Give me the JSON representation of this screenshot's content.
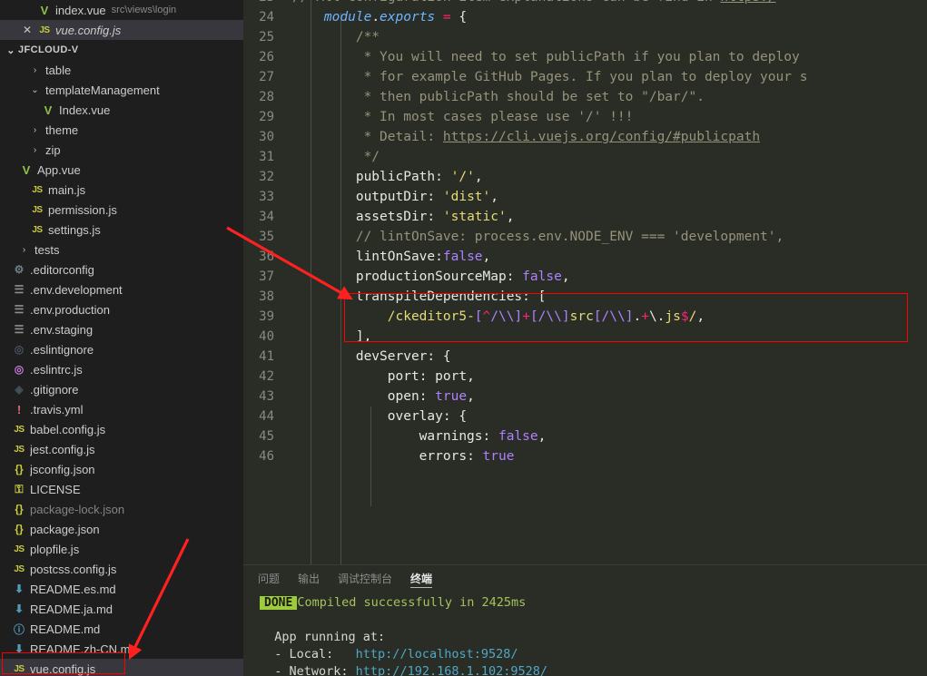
{
  "window": {
    "theme": "dark",
    "editor_bg": "#2a2c26",
    "sidebar_bg": "#1e1e1e",
    "annotation_color": "#ff0000"
  },
  "open_editors": [
    {
      "icon": "vue-icon",
      "name": "index.vue",
      "path": "src\\views\\login",
      "active": false,
      "close": ""
    },
    {
      "icon": "js-icon",
      "name": "vue.config.js",
      "path": "",
      "active": true,
      "close": "✕"
    }
  ],
  "explorer": {
    "root_label": "JFCLOUD-V",
    "root_twisty": "⌄",
    "items": [
      {
        "label": "table",
        "icon": "folder-chevron",
        "chev": "›",
        "indent": 3,
        "kind": "folder"
      },
      {
        "label": "templateManagement",
        "icon": "folder-chevron",
        "chev": "⌄",
        "indent": 3,
        "kind": "folder"
      },
      {
        "label": "Index.vue",
        "icon": "vue-icon",
        "chev": "",
        "indent": 4,
        "kind": "file"
      },
      {
        "label": "theme",
        "icon": "folder-chevron",
        "chev": "›",
        "indent": 3,
        "kind": "folder"
      },
      {
        "label": "zip",
        "icon": "folder-chevron",
        "chev": "›",
        "indent": 3,
        "kind": "folder"
      },
      {
        "label": "App.vue",
        "icon": "vue-icon",
        "chev": "",
        "indent": 2,
        "kind": "file"
      },
      {
        "label": "main.js",
        "icon": "js-icon",
        "chev": "",
        "indent": 3,
        "kind": "file"
      },
      {
        "label": "permission.js",
        "icon": "js-icon",
        "chev": "",
        "indent": 3,
        "kind": "file"
      },
      {
        "label": "settings.js",
        "icon": "js-icon",
        "chev": "",
        "indent": 3,
        "kind": "file"
      },
      {
        "label": "tests",
        "icon": "folder-chevron",
        "chev": "›",
        "indent": 2,
        "kind": "folder"
      },
      {
        "label": ".editorconfig",
        "icon": "gear-icon",
        "chev": "",
        "indent": 1,
        "kind": "file"
      },
      {
        "label": ".env.development",
        "icon": "env-icon",
        "chev": "",
        "indent": 1,
        "kind": "file"
      },
      {
        "label": ".env.production",
        "icon": "env-icon",
        "chev": "",
        "indent": 1,
        "kind": "file"
      },
      {
        "label": ".env.staging",
        "icon": "env-icon",
        "chev": "",
        "indent": 1,
        "kind": "file"
      },
      {
        "label": ".eslintignore",
        "icon": "eslint-grey-icon",
        "chev": "",
        "indent": 1,
        "kind": "file"
      },
      {
        "label": ".eslintrc.js",
        "icon": "eslint-purple-icon",
        "chev": "",
        "indent": 1,
        "kind": "file"
      },
      {
        "label": ".gitignore",
        "icon": "git-icon",
        "chev": "",
        "indent": 1,
        "kind": "file"
      },
      {
        "label": ".travis.yml",
        "icon": "yml-icon",
        "chev": "",
        "indent": 1,
        "kind": "file"
      },
      {
        "label": "babel.config.js",
        "icon": "js-icon",
        "chev": "",
        "indent": 1,
        "kind": "file"
      },
      {
        "label": "jest.config.js",
        "icon": "js-icon",
        "chev": "",
        "indent": 1,
        "kind": "file"
      },
      {
        "label": "jsconfig.json",
        "icon": "json-icon",
        "chev": "",
        "indent": 1,
        "kind": "file"
      },
      {
        "label": "LICENSE",
        "icon": "license-icon",
        "chev": "",
        "indent": 1,
        "kind": "file"
      },
      {
        "label": "package-lock.json",
        "icon": "json-icon",
        "chev": "",
        "indent": 1,
        "kind": "file",
        "dim": true
      },
      {
        "label": "package.json",
        "icon": "json-icon",
        "chev": "",
        "indent": 1,
        "kind": "file"
      },
      {
        "label": "plopfile.js",
        "icon": "js-icon",
        "chev": "",
        "indent": 1,
        "kind": "file"
      },
      {
        "label": "postcss.config.js",
        "icon": "js-icon",
        "chev": "",
        "indent": 1,
        "kind": "file"
      },
      {
        "label": "README.es.md",
        "icon": "md-icon",
        "chev": "",
        "indent": 1,
        "kind": "file"
      },
      {
        "label": "README.ja.md",
        "icon": "md-icon",
        "chev": "",
        "indent": 1,
        "kind": "file"
      },
      {
        "label": "README.md",
        "icon": "md-info-icon",
        "chev": "",
        "indent": 1,
        "kind": "file"
      },
      {
        "label": "README.zh-CN.md",
        "icon": "md-icon",
        "chev": "",
        "indent": 1,
        "kind": "file"
      },
      {
        "label": "vue.config.js",
        "icon": "js-icon",
        "chev": "",
        "indent": 1,
        "kind": "file",
        "selected": true
      }
    ]
  },
  "code": {
    "language": "javascript",
    "file": "vue.config.js",
    "lines": [
      {
        "num": "23",
        "partial_top": true,
        "tokens": [
          {
            "t": "// All configuration item explanations can be find in ",
            "c": "cmt"
          },
          {
            "t": "https:/",
            "c": "link"
          }
        ]
      },
      {
        "num": "24",
        "tokens": [
          {
            "t": "    ",
            "c": "def"
          },
          {
            "t": "module",
            "c": "key"
          },
          {
            "t": ".",
            "c": "def"
          },
          {
            "t": "exports",
            "c": "key"
          },
          {
            "t": " ",
            "c": "def"
          },
          {
            "t": "=",
            "c": "op"
          },
          {
            "t": " ",
            "c": "def"
          },
          {
            "t": "{",
            "c": "brace"
          }
        ]
      },
      {
        "num": "25",
        "tokens": [
          {
            "t": "        /**",
            "c": "cmt"
          }
        ]
      },
      {
        "num": "26",
        "tokens": [
          {
            "t": "         * You will need to set publicPath if you plan to deploy",
            "c": "cmt"
          }
        ]
      },
      {
        "num": "27",
        "tokens": [
          {
            "t": "         * for example GitHub Pages. If you plan to deploy your s",
            "c": "cmt"
          }
        ]
      },
      {
        "num": "28",
        "tokens": [
          {
            "t": "         * then publicPath should be set to \"/bar/\".",
            "c": "cmt"
          }
        ]
      },
      {
        "num": "29",
        "tokens": [
          {
            "t": "         * In most cases please use '/' !!!",
            "c": "cmt"
          }
        ]
      },
      {
        "num": "30",
        "tokens": [
          {
            "t": "         * Detail: ",
            "c": "cmt"
          },
          {
            "t": "https://cli.vuejs.org/config/#publicpath",
            "c": "link"
          }
        ]
      },
      {
        "num": "31",
        "tokens": [
          {
            "t": "         */",
            "c": "cmt"
          }
        ]
      },
      {
        "num": "32",
        "tokens": [
          {
            "t": "        publicPath",
            "c": "prop"
          },
          {
            "t": ": ",
            "c": "def"
          },
          {
            "t": "'/'",
            "c": "str"
          },
          {
            "t": ",",
            "c": "def"
          }
        ]
      },
      {
        "num": "33",
        "tokens": [
          {
            "t": "        outputDir",
            "c": "prop"
          },
          {
            "t": ": ",
            "c": "def"
          },
          {
            "t": "'dist'",
            "c": "str"
          },
          {
            "t": ",",
            "c": "def"
          }
        ]
      },
      {
        "num": "34",
        "tokens": [
          {
            "t": "        assetsDir",
            "c": "prop"
          },
          {
            "t": ": ",
            "c": "def"
          },
          {
            "t": "'static'",
            "c": "str"
          },
          {
            "t": ",",
            "c": "def"
          }
        ]
      },
      {
        "num": "35",
        "tokens": [
          {
            "t": "        // lintOnSave: process.env.NODE_ENV === 'development',",
            "c": "cmt"
          }
        ]
      },
      {
        "num": "36",
        "tokens": [
          {
            "t": "        lintOnSave",
            "c": "prop"
          },
          {
            "t": ":",
            "c": "def"
          },
          {
            "t": "false",
            "c": "const"
          },
          {
            "t": ",",
            "c": "def"
          }
        ]
      },
      {
        "num": "37",
        "tokens": [
          {
            "t": "        productionSourceMap",
            "c": "prop"
          },
          {
            "t": ": ",
            "c": "def"
          },
          {
            "t": "false",
            "c": "const"
          },
          {
            "t": ",",
            "c": "def"
          }
        ]
      },
      {
        "num": "38",
        "tokens": [
          {
            "t": "        transpileDependencies",
            "c": "prop"
          },
          {
            "t": ": ",
            "c": "def"
          },
          {
            "t": "[",
            "c": "brace"
          }
        ]
      },
      {
        "num": "39",
        "tokens": [
          {
            "t": "            ",
            "c": "def"
          },
          {
            "t": "/ckeditor5-",
            "c": "rx-yellow"
          },
          {
            "t": "[",
            "c": "rx-purple"
          },
          {
            "t": "^",
            "c": "rx-pink"
          },
          {
            "t": "/\\\\",
            "c": "rx-purple"
          },
          {
            "t": "]",
            "c": "rx-purple"
          },
          {
            "t": "+",
            "c": "rx-pink"
          },
          {
            "t": "[",
            "c": "rx-purple"
          },
          {
            "t": "/\\\\",
            "c": "rx-purple"
          },
          {
            "t": "]",
            "c": "rx-purple"
          },
          {
            "t": "src",
            "c": "rx-yellow"
          },
          {
            "t": "[",
            "c": "rx-purple"
          },
          {
            "t": "/\\\\",
            "c": "rx-purple"
          },
          {
            "t": "]",
            "c": "rx-purple"
          },
          {
            "t": ".",
            "c": "rx-white"
          },
          {
            "t": "+",
            "c": "rx-pink"
          },
          {
            "t": "\\.",
            "c": "rx-white"
          },
          {
            "t": "js",
            "c": "rx-yellow"
          },
          {
            "t": "$",
            "c": "rx-pink"
          },
          {
            "t": "/",
            "c": "rx-yellow"
          },
          {
            "t": ",",
            "c": "def"
          }
        ]
      },
      {
        "num": "40",
        "tokens": [
          {
            "t": "        ],",
            "c": "def"
          }
        ]
      },
      {
        "num": "41",
        "tokens": [
          {
            "t": "        devServer",
            "c": "prop"
          },
          {
            "t": ": ",
            "c": "def"
          },
          {
            "t": "{",
            "c": "brace"
          }
        ]
      },
      {
        "num": "42",
        "tokens": [
          {
            "t": "            port",
            "c": "prop"
          },
          {
            "t": ": ",
            "c": "def"
          },
          {
            "t": "port",
            "c": "def"
          },
          {
            "t": ",",
            "c": "def"
          }
        ]
      },
      {
        "num": "43",
        "tokens": [
          {
            "t": "            open",
            "c": "prop"
          },
          {
            "t": ": ",
            "c": "def"
          },
          {
            "t": "true",
            "c": "const"
          },
          {
            "t": ",",
            "c": "def"
          }
        ]
      },
      {
        "num": "44",
        "tokens": [
          {
            "t": "            overlay",
            "c": "prop"
          },
          {
            "t": ": ",
            "c": "def"
          },
          {
            "t": "{",
            "c": "brace"
          }
        ]
      },
      {
        "num": "45",
        "tokens": [
          {
            "t": "                warnings",
            "c": "prop"
          },
          {
            "t": ": ",
            "c": "def"
          },
          {
            "t": "false",
            "c": "const"
          },
          {
            "t": ",",
            "c": "def"
          }
        ]
      },
      {
        "num": "46",
        "partial_bottom": true,
        "tokens": [
          {
            "t": "                errors",
            "c": "prop"
          },
          {
            "t": ": ",
            "c": "def"
          },
          {
            "t": "true",
            "c": "const"
          }
        ]
      }
    ]
  },
  "panel": {
    "tabs": [
      {
        "label": "问题",
        "active": false
      },
      {
        "label": "输出",
        "active": false
      },
      {
        "label": "调试控制台",
        "active": false
      },
      {
        "label": "终端",
        "active": true
      }
    ],
    "terminal": {
      "status_badge": "DONE",
      "status_message": "Compiled successfully in 2425ms",
      "blank": "",
      "running_label": "  App running at:",
      "local_label": "  - Local:   ",
      "local_url": "http://localhost:9528/",
      "network_label": "  - Network: ",
      "network_url": "http://192.168.1.102:9528/"
    }
  },
  "annotations": {
    "highlight_box_label": "highlighted-code-region",
    "sidebar_box_label": "highlighted-file-vue-config",
    "arrow_count": 2
  }
}
